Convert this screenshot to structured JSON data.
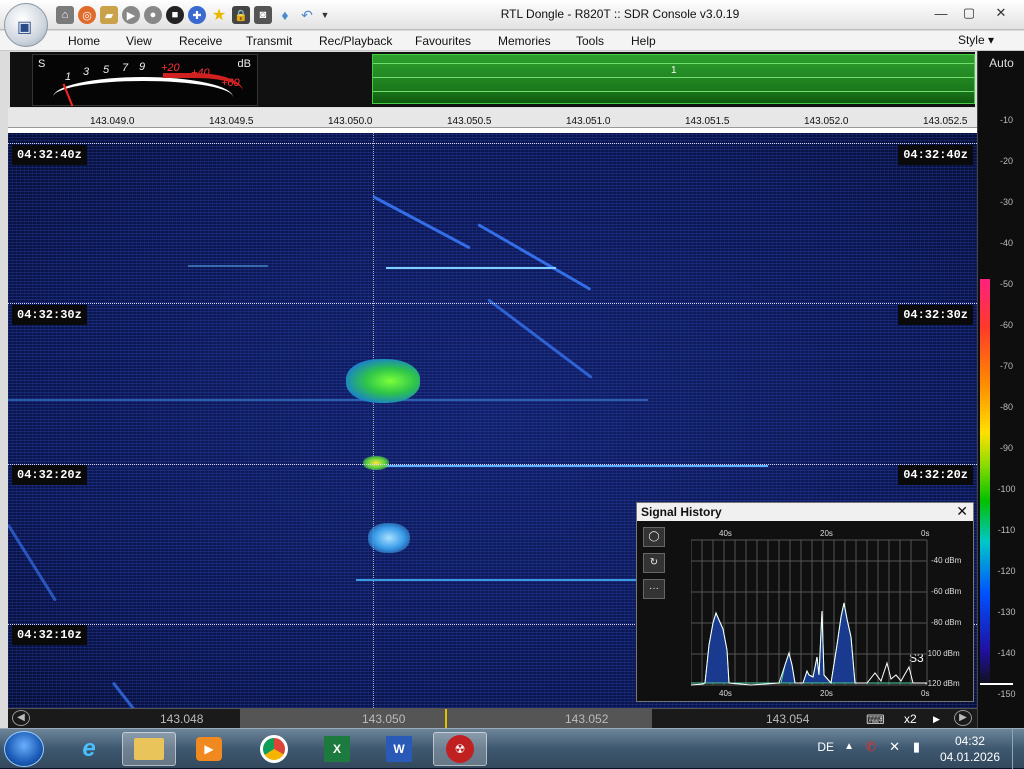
{
  "window": {
    "title": "RTL Dongle - R820T :: SDR Console v3.0.19",
    "controls": {
      "minimize": "—",
      "maximize": "▢",
      "close": "✕"
    }
  },
  "quick_access": [
    "home-icon",
    "power-icon",
    "folder-icon",
    "play-icon",
    "record-icon",
    "stop-icon",
    "plus-icon",
    "star-icon",
    "lock-icon",
    "camera-icon",
    "drop-icon",
    "undo-icon",
    "dropdown-icon"
  ],
  "menu": {
    "items": [
      "Home",
      "View",
      "Receive",
      "Transmit",
      "Rec/Playback",
      "Favourites",
      "Memories",
      "Tools",
      "Help"
    ],
    "style_label": "Style"
  },
  "meter": {
    "s_label": "S",
    "db_label": "dB",
    "s_scale": [
      "1",
      "3",
      "5",
      "7",
      "9"
    ],
    "db_scale": [
      "+20",
      "+40",
      "+60"
    ]
  },
  "spectrum": {
    "marker": "1"
  },
  "freq_axis": {
    "labels": [
      "143.049.0",
      "143.049.5",
      "143.050.0",
      "143.050.5",
      "143.051.0",
      "143.051.5",
      "143.052.0",
      "143.052.5"
    ]
  },
  "waterfall": {
    "timestamps": [
      "04:32:40z",
      "04:32:30z",
      "04:32:20z",
      "04:32:10z"
    ]
  },
  "db_scale": {
    "auto_label": "Auto",
    "levels": [
      "-10",
      "-20",
      "-30",
      "-40",
      "-50",
      "-60",
      "-70",
      "-80",
      "-90",
      "-100",
      "-110",
      "-120",
      "-130",
      "-140",
      "-150"
    ]
  },
  "signal_history": {
    "title": "Signal History",
    "close": "✕",
    "buttons": [
      "◯",
      "↻",
      "···"
    ],
    "top_labels": [
      "40s",
      "20s",
      "0s"
    ],
    "bottom_labels": [
      "40s",
      "20s",
      "0s"
    ],
    "dbm_labels": [
      "-40 dBm",
      "-60 dBm",
      "-80 dBm",
      "-100 dBm",
      "-120 dBm"
    ],
    "s_reading": "S3"
  },
  "bottom_bar": {
    "labels": [
      "143.048",
      "143.050",
      "143.052",
      "143.054"
    ],
    "zoom": "x2"
  },
  "taskbar": {
    "apps": [
      "ie-icon",
      "explorer-icon",
      "media-player-icon",
      "chrome-icon",
      "excel-icon",
      "word-icon",
      "sdr-console-icon"
    ],
    "language": "DE",
    "time": "04:32",
    "date": "04.01.2026"
  },
  "colors": {
    "spectrum_green": "#2ea02e",
    "waterfall_bg": "#0b1650",
    "signal_green": "#3cdc3c"
  }
}
